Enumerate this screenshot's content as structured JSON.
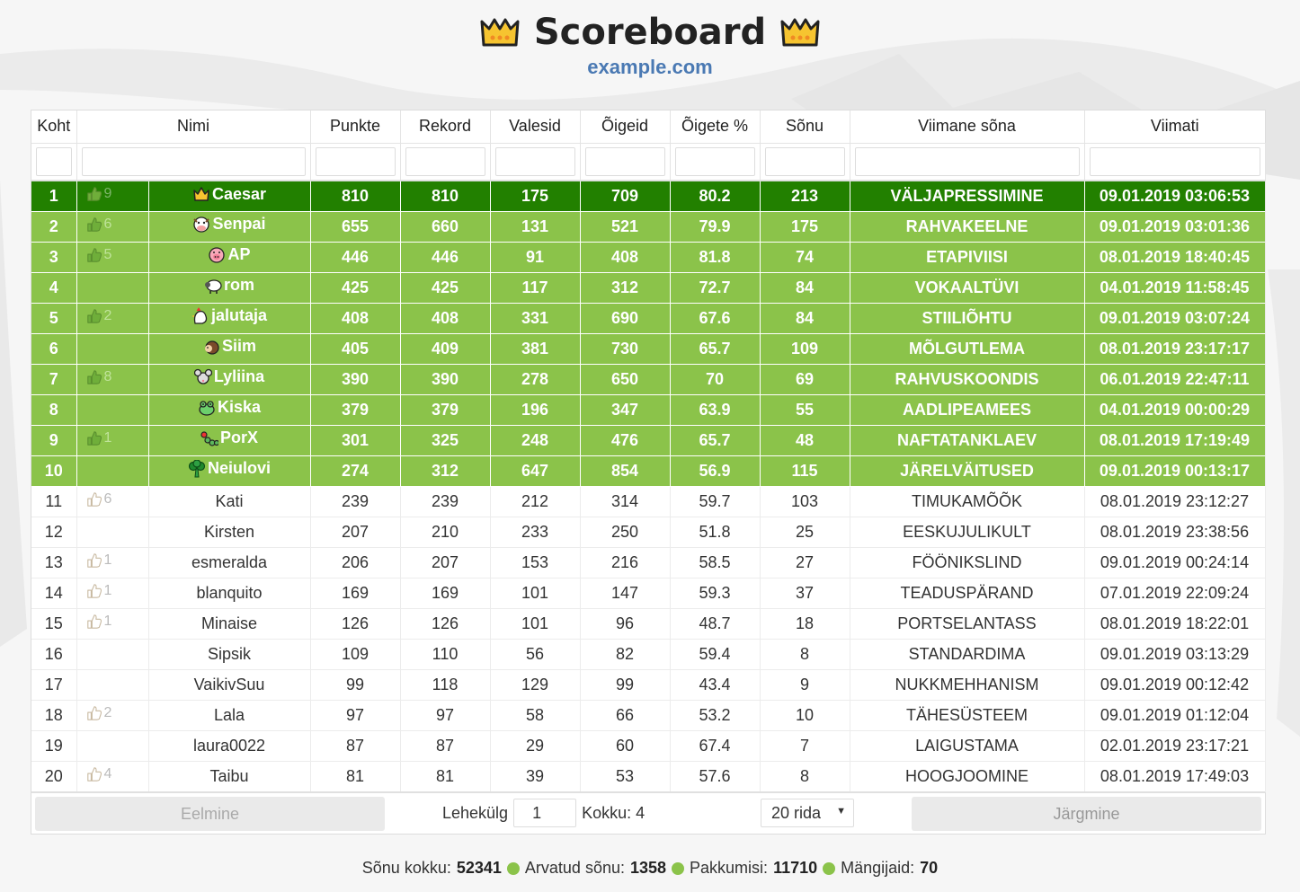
{
  "header": {
    "title": "Scoreboard",
    "subtitle": "example.com"
  },
  "columns": [
    "Koht",
    "",
    "Nimi",
    "Punkte",
    "Rekord",
    "Valesid",
    "Õigeid",
    "Õigete %",
    "Sõnu",
    "Viimane sõna",
    "Viimati"
  ],
  "rows": [
    {
      "rank": "1",
      "likes": "9",
      "name": "Caesar",
      "icon": "crown-icon",
      "points": "810",
      "record": "810",
      "wrong": "175",
      "right": "709",
      "pct": "80.2",
      "words": "213",
      "last_word": "VÄLJAPRESSIMINE",
      "last_time": "09.01.2019 03:06:53"
    },
    {
      "rank": "2",
      "likes": "6",
      "name": "Senpai",
      "icon": "cow-icon",
      "points": "655",
      "record": "660",
      "wrong": "131",
      "right": "521",
      "pct": "79.9",
      "words": "175",
      "last_word": "RAHVAKEELNE",
      "last_time": "09.01.2019 03:01:36"
    },
    {
      "rank": "3",
      "likes": "5",
      "name": "AP",
      "icon": "pig-icon",
      "points": "446",
      "record": "446",
      "wrong": "91",
      "right": "408",
      "pct": "81.8",
      "words": "74",
      "last_word": "ETAPIVIISI",
      "last_time": "08.01.2019 18:40:45"
    },
    {
      "rank": "4",
      "likes": "",
      "name": "rom",
      "icon": "sheep-icon",
      "points": "425",
      "record": "425",
      "wrong": "117",
      "right": "312",
      "pct": "72.7",
      "words": "84",
      "last_word": "VOKAALTÜVI",
      "last_time": "04.01.2019 11:58:45"
    },
    {
      "rank": "5",
      "likes": "2",
      "name": "jalutaja",
      "icon": "chicken-icon",
      "points": "408",
      "record": "408",
      "wrong": "331",
      "right": "690",
      "pct": "67.6",
      "words": "84",
      "last_word": "STIILIÕHTU",
      "last_time": "09.01.2019 03:07:24"
    },
    {
      "rank": "6",
      "likes": "",
      "name": "Siim",
      "icon": "hedgehog-icon",
      "points": "405",
      "record": "409",
      "wrong": "381",
      "right": "730",
      "pct": "65.7",
      "words": "109",
      "last_word": "MÕLGUTLEMA",
      "last_time": "08.01.2019 23:17:17"
    },
    {
      "rank": "7",
      "likes": "8",
      "name": "Lyliina",
      "icon": "mouse-icon",
      "points": "390",
      "record": "390",
      "wrong": "278",
      "right": "650",
      "pct": "70",
      "words": "69",
      "last_word": "RAHVUSKOONDIS",
      "last_time": "06.01.2019 22:47:11"
    },
    {
      "rank": "8",
      "likes": "",
      "name": "Kiska",
      "icon": "frog-icon",
      "points": "379",
      "record": "379",
      "wrong": "196",
      "right": "347",
      "pct": "63.9",
      "words": "55",
      "last_word": "AADLIPEAMEES",
      "last_time": "04.01.2019 00:00:29"
    },
    {
      "rank": "9",
      "likes": "1",
      "name": "PorX",
      "icon": "caterpillar-icon",
      "points": "301",
      "record": "325",
      "wrong": "248",
      "right": "476",
      "pct": "65.7",
      "words": "48",
      "last_word": "NAFTATANKLAEV",
      "last_time": "08.01.2019 17:19:49"
    },
    {
      "rank": "10",
      "likes": "",
      "name": "Neiulovi",
      "icon": "broccoli-icon",
      "points": "274",
      "record": "312",
      "wrong": "647",
      "right": "854",
      "pct": "56.9",
      "words": "115",
      "last_word": "JÄRELVÄITUSED",
      "last_time": "09.01.2019 00:13:17"
    },
    {
      "rank": "11",
      "likes": "6",
      "name": "Kati",
      "icon": "",
      "points": "239",
      "record": "239",
      "wrong": "212",
      "right": "314",
      "pct": "59.7",
      "words": "103",
      "last_word": "TIMUKAMÕÕK",
      "last_time": "08.01.2019 23:12:27"
    },
    {
      "rank": "12",
      "likes": "",
      "name": "Kirsten",
      "icon": "",
      "points": "207",
      "record": "210",
      "wrong": "233",
      "right": "250",
      "pct": "51.8",
      "words": "25",
      "last_word": "EESKUJULIKULT",
      "last_time": "08.01.2019 23:38:56"
    },
    {
      "rank": "13",
      "likes": "1",
      "name": "esmeralda",
      "icon": "",
      "points": "206",
      "record": "207",
      "wrong": "153",
      "right": "216",
      "pct": "58.5",
      "words": "27",
      "last_word": "FÖÖNIKSLIND",
      "last_time": "09.01.2019 00:24:14"
    },
    {
      "rank": "14",
      "likes": "1",
      "name": "blanquito",
      "icon": "",
      "points": "169",
      "record": "169",
      "wrong": "101",
      "right": "147",
      "pct": "59.3",
      "words": "37",
      "last_word": "TEADUSPÄRAND",
      "last_time": "07.01.2019 22:09:24"
    },
    {
      "rank": "15",
      "likes": "1",
      "name": "Minaise",
      "icon": "",
      "points": "126",
      "record": "126",
      "wrong": "101",
      "right": "96",
      "pct": "48.7",
      "words": "18",
      "last_word": "PORTSELANTASS",
      "last_time": "08.01.2019 18:22:01"
    },
    {
      "rank": "16",
      "likes": "",
      "name": "Sipsik",
      "icon": "",
      "points": "109",
      "record": "110",
      "wrong": "56",
      "right": "82",
      "pct": "59.4",
      "words": "8",
      "last_word": "STANDARDIMA",
      "last_time": "09.01.2019 03:13:29"
    },
    {
      "rank": "17",
      "likes": "",
      "name": "VaikivSuu",
      "icon": "",
      "points": "99",
      "record": "118",
      "wrong": "129",
      "right": "99",
      "pct": "43.4",
      "words": "9",
      "last_word": "NUKKMEHHANISM",
      "last_time": "09.01.2019 00:12:42"
    },
    {
      "rank": "18",
      "likes": "2",
      "name": "Lala",
      "icon": "",
      "points": "97",
      "record": "97",
      "wrong": "58",
      "right": "66",
      "pct": "53.2",
      "words": "10",
      "last_word": "TÄHESÜSTEEM",
      "last_time": "09.01.2019 01:12:04"
    },
    {
      "rank": "19",
      "likes": "",
      "name": "laura0022",
      "icon": "",
      "points": "87",
      "record": "87",
      "wrong": "29",
      "right": "60",
      "pct": "67.4",
      "words": "7",
      "last_word": "LAIGUSTAMA",
      "last_time": "02.01.2019 23:17:21"
    },
    {
      "rank": "20",
      "likes": "4",
      "name": "Taibu",
      "icon": "",
      "points": "81",
      "record": "81",
      "wrong": "39",
      "right": "53",
      "pct": "57.6",
      "words": "8",
      "last_word": "HOOGJOOMINE",
      "last_time": "08.01.2019 17:49:03"
    }
  ],
  "pager": {
    "prev_label": "Eelmine",
    "next_label": "Järgmine",
    "page_label": "Lehekülg",
    "page_value": "1",
    "total_label": "Kokku: 4",
    "rows_select": "20 rida"
  },
  "footer": {
    "words_label": "Sõnu kokku:",
    "words_value": "52341",
    "guessed_label": "Arvatud sõnu:",
    "guessed_value": "1358",
    "offers_label": "Pakkumisi:",
    "offers_value": "11710",
    "players_label": "Mängijaid:",
    "players_value": "70"
  },
  "colors": {
    "first_row": "#228000",
    "top_rows": "#8bc34a",
    "subtitle": "#4a79b3"
  }
}
